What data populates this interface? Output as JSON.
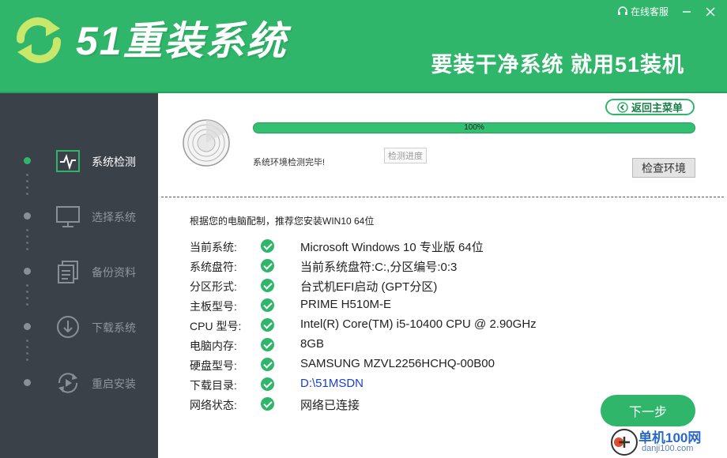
{
  "header": {
    "logo_text": "51重装系统",
    "slogan": "要装干净系统  就用51装机",
    "service_label": "在线客服",
    "icons": {
      "logo": "refresh-arrows-icon",
      "service": "headset-icon",
      "minimize": "minimize-icon",
      "close": "close-icon"
    }
  },
  "sidebar": {
    "items": [
      {
        "label": "系统检测",
        "icon": "monitor-pulse-icon",
        "active": true
      },
      {
        "label": "选择系统",
        "icon": "desktop-icon",
        "active": false
      },
      {
        "label": "备份资料",
        "icon": "documents-icon",
        "active": false
      },
      {
        "label": "下载系统",
        "icon": "download-icon",
        "active": false
      },
      {
        "label": "重启安装",
        "icon": "restart-play-icon",
        "active": false
      }
    ]
  },
  "main": {
    "back_label": "返回主菜单",
    "progress_percent": 100,
    "progress_label": "100%",
    "status_text": "系统环境检测完毕!",
    "tooltip": "检测进度",
    "check_button": "检查环境",
    "recommend_text": "根据您的电脑配制，推荐您安装WIN10 64位",
    "info": [
      {
        "label": "当前系统:",
        "value": "Microsoft Windows 10 专业版 64位"
      },
      {
        "label": "系统盘符:",
        "value": "当前系统盘符:C:,分区编号:0:3"
      },
      {
        "label": "分区形式:",
        "value": "台式机EFI启动 (GPT分区)"
      },
      {
        "label": "主板型号:",
        "value": "PRIME H510M-E"
      },
      {
        "label": "CPU 型号:",
        "value": "Intel(R) Core(TM) i5-10400 CPU @ 2.90GHz"
      },
      {
        "label": "电脑内存:",
        "value": "8GB"
      },
      {
        "label": "硬盘型号:",
        "value": "SAMSUNG MZVL2256HCHQ-00B00"
      },
      {
        "label": "下载目录:",
        "value": "D:\\51MSDN"
      },
      {
        "label": "网络状态:",
        "value": "网络已连接"
      }
    ],
    "next_label": "下一步"
  },
  "watermark": {
    "title": "单机100网",
    "url": "danji100.com"
  },
  "colors": {
    "brand_green": "#2fb66a",
    "sidebar_bg": "#3b4149",
    "link_blue": "#1a3fcf"
  }
}
